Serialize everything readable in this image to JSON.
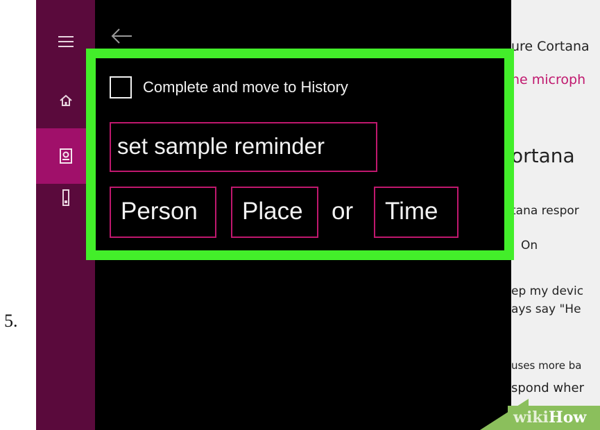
{
  "step_number": "5.",
  "nav": {
    "items": [
      {
        "name": "menu",
        "icon": "hamburger-menu-icon"
      },
      {
        "name": "home",
        "icon": "home-icon"
      },
      {
        "name": "notebook",
        "icon": "notebook-icon",
        "active": true
      },
      {
        "name": "reminders",
        "icon": "device-icon"
      }
    ]
  },
  "reminder": {
    "checkbox_label": "Complete and move to History",
    "title_value": "set sample reminder",
    "options": [
      "Person",
      "Place",
      "Time"
    ],
    "separator": "or"
  },
  "settings_panel": {
    "lines": [
      "ure Cortana",
      "he microph",
      "ortana",
      "tana respor",
      "On",
      "ep my devic",
      "ays say \"He",
      "uses more ba",
      "spond wher"
    ]
  },
  "watermark": {
    "part1": "wiki",
    "part2": "How"
  },
  "colors": {
    "nav_bg": "#5a0a3c",
    "nav_active": "#a0106a",
    "accent_magenta": "#c0186e",
    "highlight_green": "#43ee2a",
    "panel_bg": "#000000",
    "watermark_green": "#8bbf5c"
  }
}
